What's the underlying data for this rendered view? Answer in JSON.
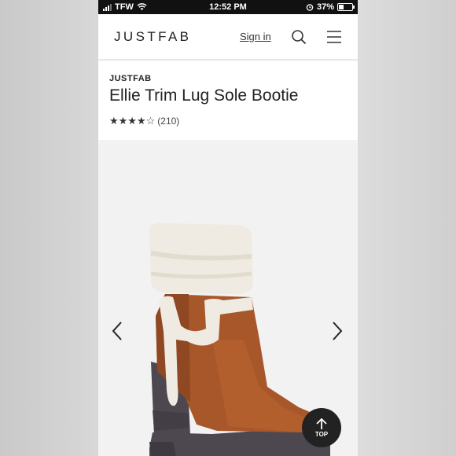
{
  "status_bar": {
    "carrier": "TFW",
    "time": "12:52 PM",
    "battery": "37%"
  },
  "header": {
    "logo": "JUSTFAB",
    "sign_in": "Sign in"
  },
  "product": {
    "brand": "JUSTFAB",
    "title": "Ellie Trim Lug Sole Bootie",
    "stars": "★★★★☆",
    "review_count": "(210)"
  },
  "gallery": {
    "top_label": "TOP"
  },
  "icons": [
    "signal-icon",
    "wifi-icon",
    "alarm-icon",
    "battery-icon",
    "search-icon",
    "menu-icon",
    "chevron-left-icon",
    "chevron-right-icon",
    "arrow-up-icon"
  ],
  "colors": {
    "boot_leather": "#a8572a",
    "sherpa": "#efeae2",
    "sole": "#4d4850",
    "top_button": "#222222"
  }
}
